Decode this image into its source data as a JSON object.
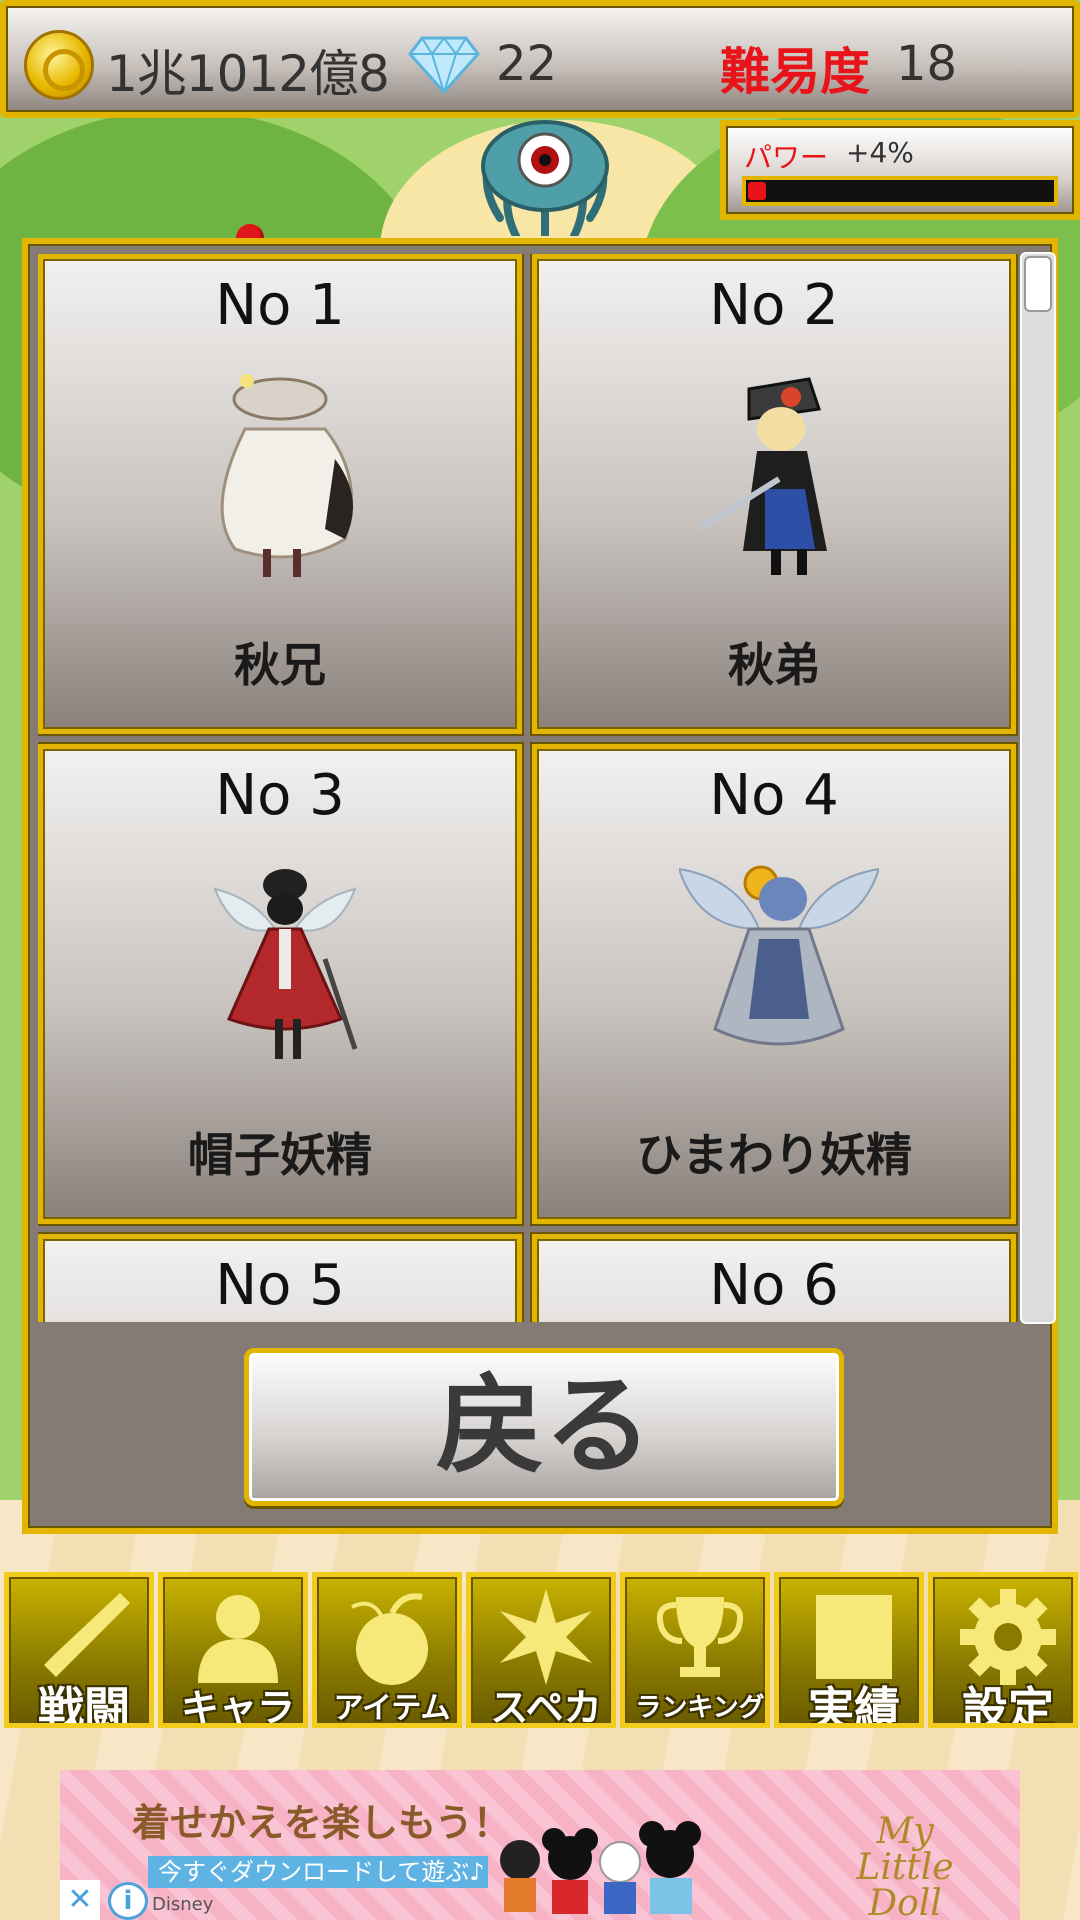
{
  "header": {
    "money": "1兆1012億8",
    "gems": "22",
    "difficulty_label": "難易度",
    "difficulty_value": "18"
  },
  "power": {
    "label": "パワー",
    "value": "+4%",
    "fill_fraction": 0.04
  },
  "characters": [
    {
      "no": "No 1",
      "name": "秋兄"
    },
    {
      "no": "No 2",
      "name": "秋弟"
    },
    {
      "no": "No 3",
      "name": "帽子妖精"
    },
    {
      "no": "No 4",
      "name": "ひまわり妖精"
    },
    {
      "no": "No 5",
      "name": ""
    },
    {
      "no": "No 6",
      "name": ""
    }
  ],
  "back_button": "戻る",
  "nav": [
    {
      "label": "戦闘",
      "icon": "sword-icon"
    },
    {
      "label": "キャラ",
      "icon": "person-icon"
    },
    {
      "label": "アイテム",
      "icon": "fruit-icon"
    },
    {
      "label": "スペカ",
      "icon": "burst-icon"
    },
    {
      "label": "ランキング",
      "icon": "trophy-icon"
    },
    {
      "label": "実績",
      "icon": "board-icon"
    },
    {
      "label": "設定",
      "icon": "gear-icon"
    }
  ],
  "ad": {
    "headline": "着せかえを楽しもう！",
    "sub": "今すぐダウンロードして遊ぶ♪",
    "logo": "My Little Doll",
    "brand": "Disney",
    "close": "✕",
    "info": "i"
  },
  "colors": {
    "gold_border": "#e2b600",
    "red_text": "#e8141a",
    "panel_bg": "#857b75"
  }
}
